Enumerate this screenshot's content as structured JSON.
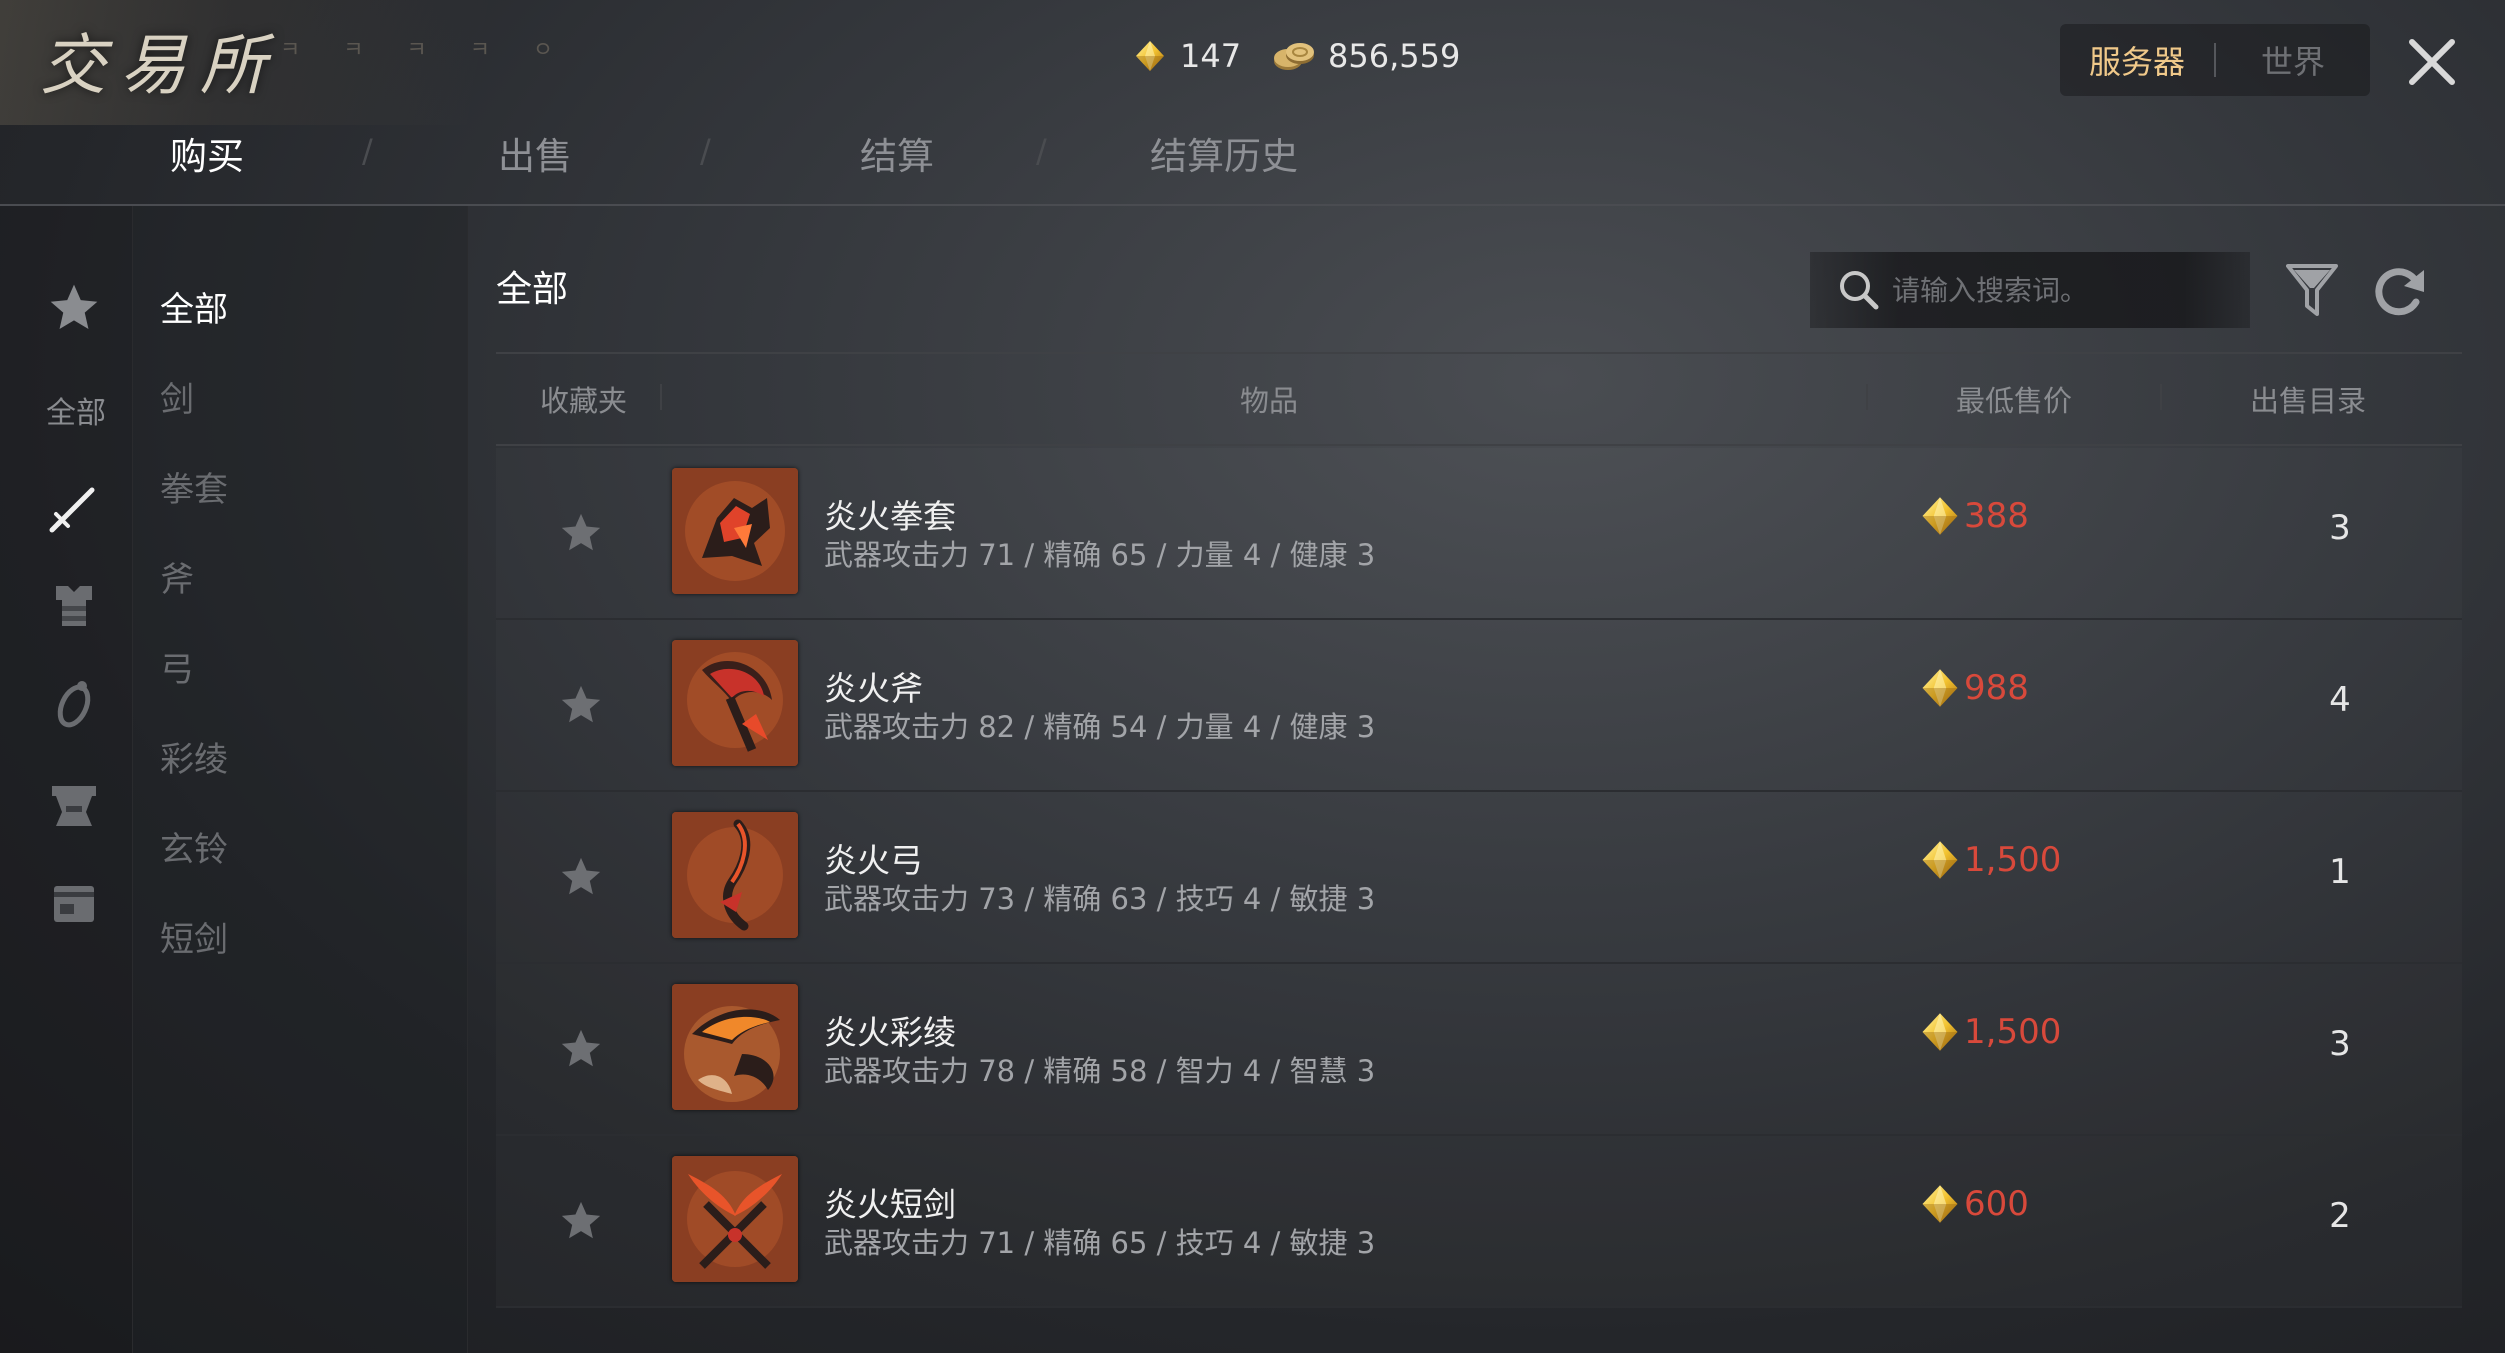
{
  "window": {
    "title": "交易所",
    "subtitle": "ㅋ ㅋ ㅋ ㅋ ㅇ"
  },
  "currency": {
    "gem_amount": "147",
    "coin_amount": "856,559"
  },
  "server_toggle": {
    "server_label": "服务器",
    "world_label": "世界",
    "selected": "server"
  },
  "tabs": [
    {
      "label": "购买",
      "active": true
    },
    {
      "label": "出售",
      "active": false
    },
    {
      "label": "结算",
      "active": false
    },
    {
      "label": "结算历史",
      "active": false
    }
  ],
  "icon_rail": {
    "all_label": "全部",
    "icons": [
      "favorite-star-icon",
      "weapon-sword-icon",
      "armor-icon",
      "accessory-ring-icon",
      "chest-icon",
      "card-icon"
    ]
  },
  "categories": [
    {
      "label": "全部",
      "active": true
    },
    {
      "label": "剑",
      "active": false
    },
    {
      "label": "拳套",
      "active": false
    },
    {
      "label": "斧",
      "active": false
    },
    {
      "label": "弓",
      "active": false
    },
    {
      "label": "彩绫",
      "active": false
    },
    {
      "label": "玄铃",
      "active": false
    },
    {
      "label": "短剑",
      "active": false
    }
  ],
  "content": {
    "title": "全部",
    "search_placeholder": "请输入搜索词。"
  },
  "table": {
    "headers": {
      "favorite": "收藏夹",
      "item": "物品",
      "lowest_price": "最低售价",
      "listings": "出售目录"
    },
    "rows": [
      {
        "name": "炎火拳套",
        "stats": "武器攻击力 71  / 精确 65  / 力量 4  / 健康 3",
        "price": "388",
        "listings": "3"
      },
      {
        "name": "炎火斧",
        "stats": "武器攻击力 82  / 精确 54  / 力量 4  / 健康 3",
        "price": "988",
        "listings": "4"
      },
      {
        "name": "炎火弓",
        "stats": "武器攻击力 73  / 精确 63  / 技巧 4  / 敏捷 3",
        "price": "1,500",
        "listings": "1"
      },
      {
        "name": "炎火彩绫",
        "stats": "武器攻击力 78  / 精确 58  / 智力 4  / 智慧 3",
        "price": "1,500",
        "listings": "3"
      },
      {
        "name": "炎火短剑",
        "stats": "武器攻击力 71  / 精确 65  / 技巧 4  / 敏捷 3",
        "price": "600",
        "listings": "2"
      }
    ]
  },
  "colors": {
    "price_red": "#d8493b",
    "gem_gold": "#f2c230",
    "bg_dark": "#24262a"
  }
}
